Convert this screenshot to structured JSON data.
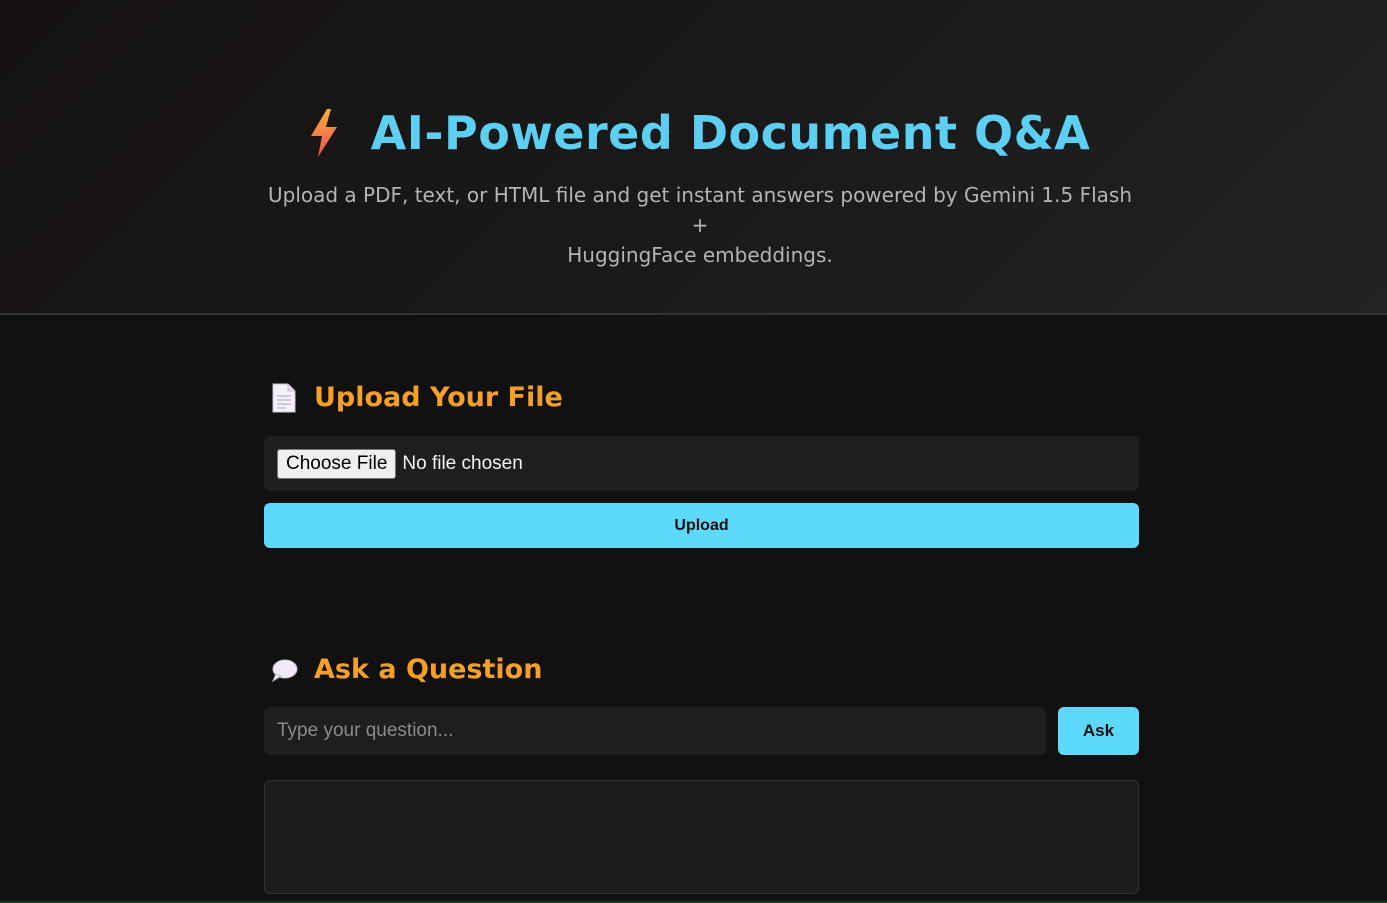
{
  "header": {
    "icon": "lightning-bolt-icon",
    "title": "AI-Powered Document Q&A",
    "subtitle_line1": "Upload a PDF, text, or HTML file and get instant answers powered by Gemini 1.5 Flash +",
    "subtitle_line2": "HuggingFace embeddings.",
    "title_color": "#5ad0f2"
  },
  "upload_section": {
    "icon": "document-icon",
    "heading": "Upload Your File",
    "file_button_label": "Choose File",
    "file_status": "No file chosen",
    "upload_button_label": "Upload"
  },
  "ask_section": {
    "icon": "speech-bubble-icon",
    "heading": "Ask a Question",
    "input_placeholder": "Type your question...",
    "input_value": "",
    "ask_button_label": "Ask",
    "answer": ""
  },
  "colors": {
    "accent": "#5cd9fb",
    "heading": "#f5a021",
    "background": "#111111"
  }
}
